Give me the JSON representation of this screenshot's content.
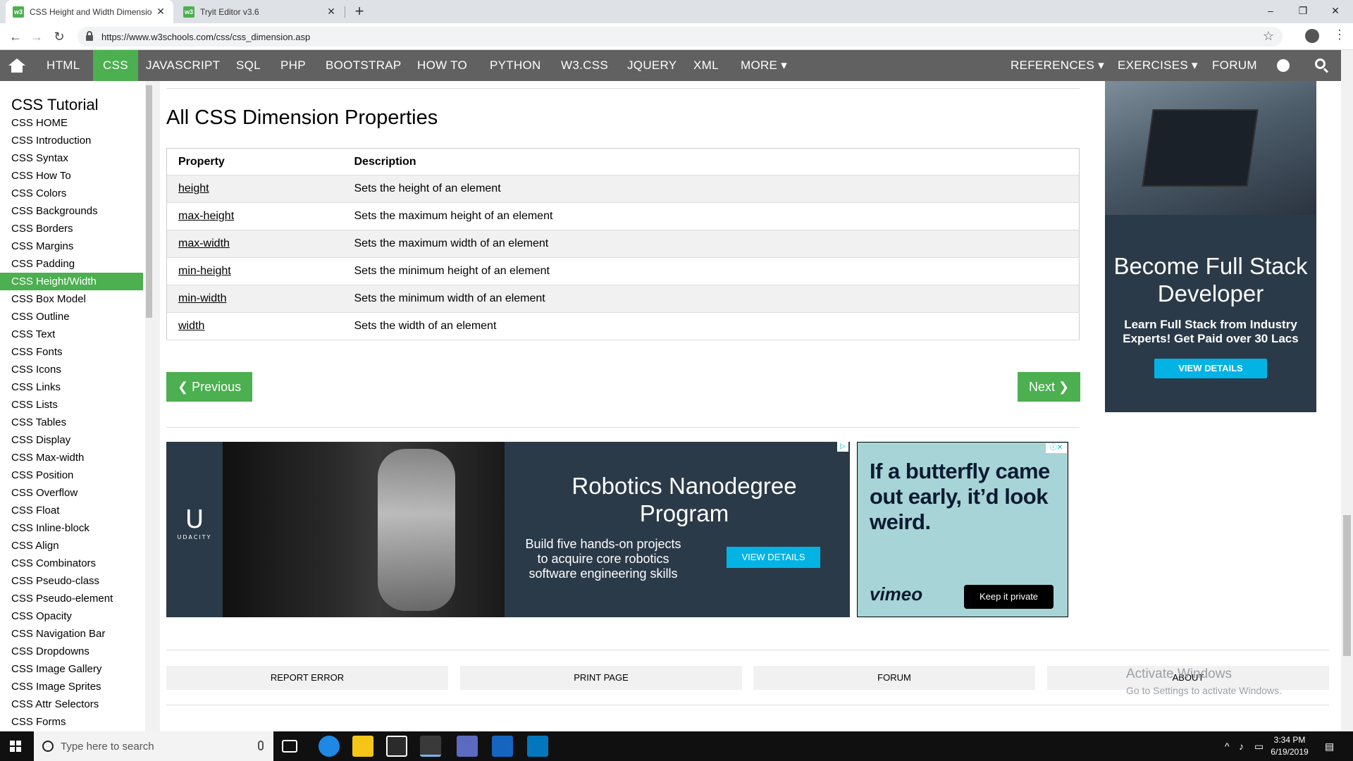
{
  "browser": {
    "tabs": [
      {
        "title": "CSS Height and Width Dimensio",
        "favicon": "w3"
      },
      {
        "title": "Tryit Editor v3.6",
        "favicon": "w3"
      }
    ],
    "url": "https://www.w3schools.com/css/css_dimension.asp",
    "window_controls": {
      "minimize": "–",
      "maximize": "❐",
      "close": "✕"
    }
  },
  "topnav": {
    "items": [
      "HTML",
      "CSS",
      "JAVASCRIPT",
      "SQL",
      "PHP",
      "BOOTSTRAP",
      "HOW TO",
      "PYTHON",
      "W3.CSS",
      "JQUERY",
      "XML",
      "MORE ▾"
    ],
    "active": "CSS",
    "right_items": [
      "REFERENCES ▾",
      "EXERCISES ▾",
      "FORUM"
    ],
    "accent_color": "#4caf50",
    "bar_color": "#616161"
  },
  "sidebar": {
    "title": "CSS Tutorial",
    "active": "CSS Height/Width",
    "items": [
      "CSS HOME",
      "CSS Introduction",
      "CSS Syntax",
      "CSS How To",
      "CSS Colors",
      "CSS Backgrounds",
      "CSS Borders",
      "CSS Margins",
      "CSS Padding",
      "CSS Height/Width",
      "CSS Box Model",
      "CSS Outline",
      "CSS Text",
      "CSS Fonts",
      "CSS Icons",
      "CSS Links",
      "CSS Lists",
      "CSS Tables",
      "CSS Display",
      "CSS Max-width",
      "CSS Position",
      "CSS Overflow",
      "CSS Float",
      "CSS Inline-block",
      "CSS Align",
      "CSS Combinators",
      "CSS Pseudo-class",
      "CSS Pseudo-element",
      "CSS Opacity",
      "CSS Navigation Bar",
      "CSS Dropdowns",
      "CSS Image Gallery",
      "CSS Image Sprites",
      "CSS Attr Selectors",
      "CSS Forms"
    ]
  },
  "main": {
    "heading": "All CSS Dimension Properties",
    "table": {
      "headers": [
        "Property",
        "Description"
      ],
      "rows": [
        {
          "property": "height",
          "description": "Sets the height of an element"
        },
        {
          "property": "max-height",
          "description": "Sets the maximum height of an element"
        },
        {
          "property": "max-width",
          "description": "Sets the maximum width of an element"
        },
        {
          "property": "min-height",
          "description": "Sets the minimum height of an element"
        },
        {
          "property": "min-width",
          "description": "Sets the minimum width of an element"
        },
        {
          "property": "width",
          "description": "Sets the width of an element"
        }
      ]
    },
    "prev_label": "❮ Previous",
    "next_label": "Next ❯"
  },
  "ads": {
    "robotics": {
      "brand": "U",
      "brand_sub": "UDACITY",
      "title": "Robotics Nanodegree Program",
      "subtitle": "Build five hands-on projects to acquire core robotics software engineering skills",
      "cta": "VIEW DETAILS"
    },
    "vimeo": {
      "headline": "If a butterfly came out early, it’d look weird.",
      "brand": "vimeo",
      "cta": "Keep it private"
    },
    "fullstack": {
      "title": "Become Full Stack Developer",
      "subtitle": "Learn Full Stack from Industry Experts! Get Paid over 30 Lacs",
      "cta": "VIEW DETAILS"
    }
  },
  "footer": {
    "buttons": [
      "REPORT ERROR",
      "PRINT PAGE",
      "FORUM",
      "ABOUT"
    ]
  },
  "watermark": {
    "title": "Activate Windows",
    "subtitle": "Go to Settings to activate Windows."
  },
  "taskbar": {
    "search_placeholder": "Type here to search",
    "time": "3:34 PM",
    "date": "6/19/2019"
  }
}
